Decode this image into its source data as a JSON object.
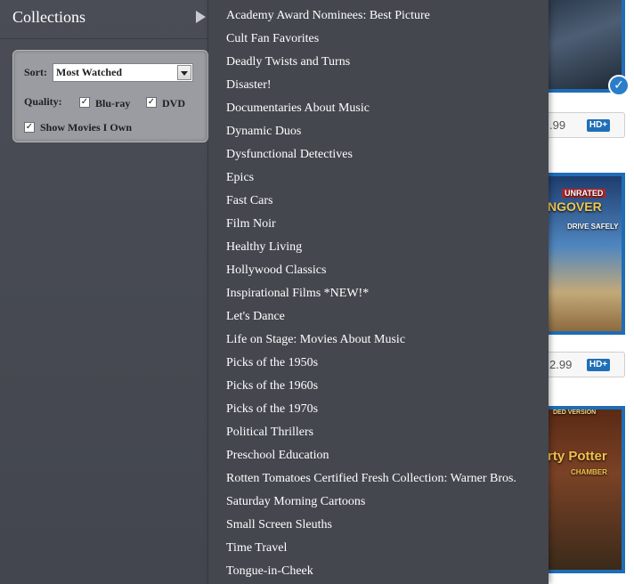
{
  "sidebar": {
    "title": "Collections",
    "filters": {
      "sort_label": "Sort:",
      "sort_value": "Most Watched",
      "quality_label": "Quality:",
      "bluray_label": "Blu-ray",
      "dvd_label": "DVD",
      "own_label": "Show Movies I Own",
      "check_glyph": "✓"
    }
  },
  "menu": {
    "items": [
      "Academy Award Nominees: Best Picture",
      "Cult Fan Favorites",
      "Deadly Twists and Turns",
      "Disaster!",
      "Documentaries About Music",
      "Dynamic Duos",
      "Dysfunctional Detectives",
      "Epics",
      "Fast Cars",
      "Film Noir",
      "Healthy Living",
      "Hollywood Classics",
      "Inspirational Films *NEW!*",
      "Let's Dance",
      "Life on Stage: Movies About Music",
      "Picks of the 1950s",
      "Picks of the 1960s",
      "Picks of the 1970s",
      "Political Thrillers",
      "Preschool Education",
      "Rotten Tomatoes Certified Fresh Collection: Warner Bros.",
      "Saturday Morning Cartoons",
      "Small Screen Sleuths",
      "Time Travel",
      "Tongue-in-Cheek"
    ]
  },
  "content": {
    "price1": ".99",
    "price2": "2.99",
    "hd_label": "HD+",
    "owned_glyph": "✓",
    "poster2_text1": "UNRATED",
    "poster2_text2": "NGOVER",
    "poster2_text3": "DRIVE SAFELY",
    "poster3_text1": "DED VERSION",
    "poster3_text2": "rty Potter",
    "poster3_text3": "CHAMBER"
  },
  "colors": {
    "sidebar_bg": "#4a4d55",
    "menu_bg": "#44474e",
    "accent_blue": "#1e6db6"
  }
}
